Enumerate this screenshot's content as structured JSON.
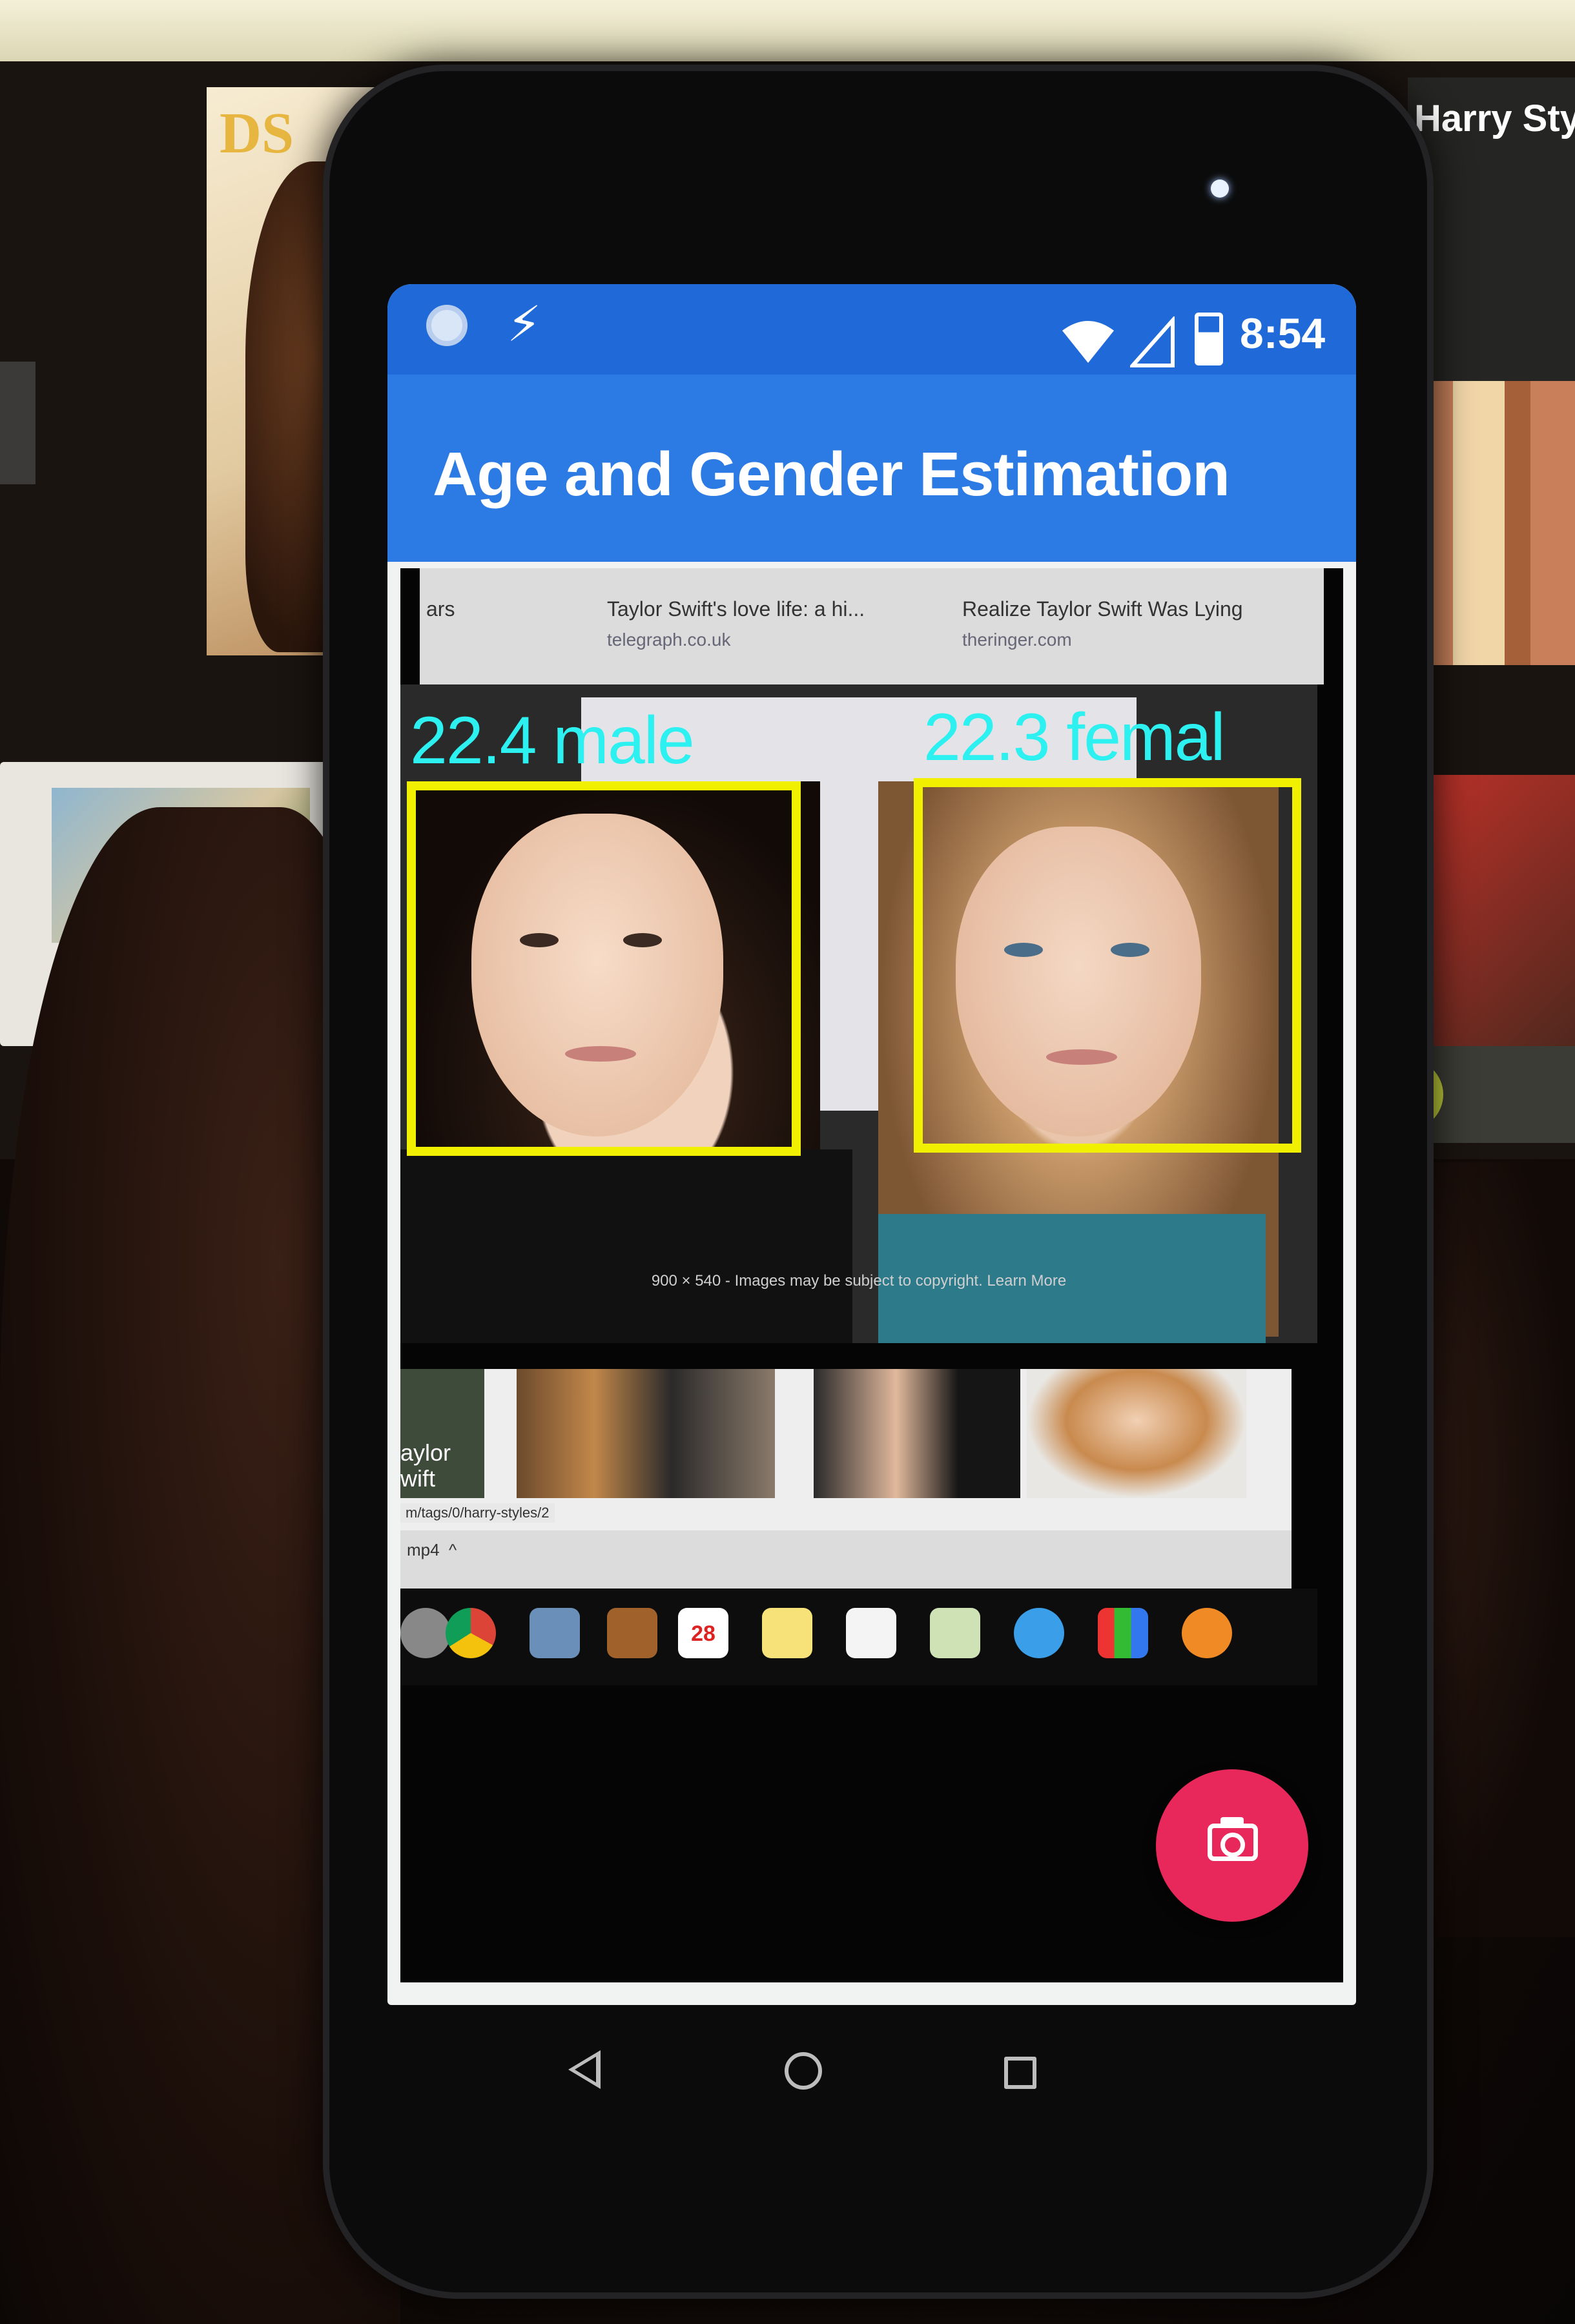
{
  "status_bar": {
    "time": "8:54"
  },
  "app": {
    "title": "Age and Gender Estimation"
  },
  "preview": {
    "search_captions": [
      {
        "title": "ars",
        "source": ""
      },
      {
        "title": "Taylor Swift's love life: a hi...",
        "source": "telegraph.co.uk"
      },
      {
        "title": "Realize Taylor Swift Was Lying",
        "source": "theringer.com"
      }
    ],
    "detections": [
      {
        "label": "22.4 male"
      },
      {
        "label": "22.3 femal"
      }
    ],
    "copyright_note": "900 × 540 - Images may be subject to copyright. Learn More",
    "url_text": "m/tags/0/harry-styles/2",
    "download_item": "mp4",
    "download_chevron": "^",
    "dock_calendar_day": "28",
    "strip_text": "aylor\nwift"
  },
  "background": {
    "right_panel_title": "Harry Style",
    "magazine_title": "DS"
  },
  "colors": {
    "status_bar": "#1f6ad8",
    "app_bar": "#2c7be4",
    "fab": "#e8285a",
    "detection_box": "#f0f000",
    "detection_label": "#2df0f0"
  },
  "icons": {
    "usb": "usb-icon",
    "wifi": "wifi-icon",
    "signal": "signal-icon",
    "battery": "battery-icon",
    "camera": "camera-icon",
    "nav_back": "back-icon",
    "nav_home": "home-icon",
    "nav_recent": "recent-apps-icon"
  }
}
